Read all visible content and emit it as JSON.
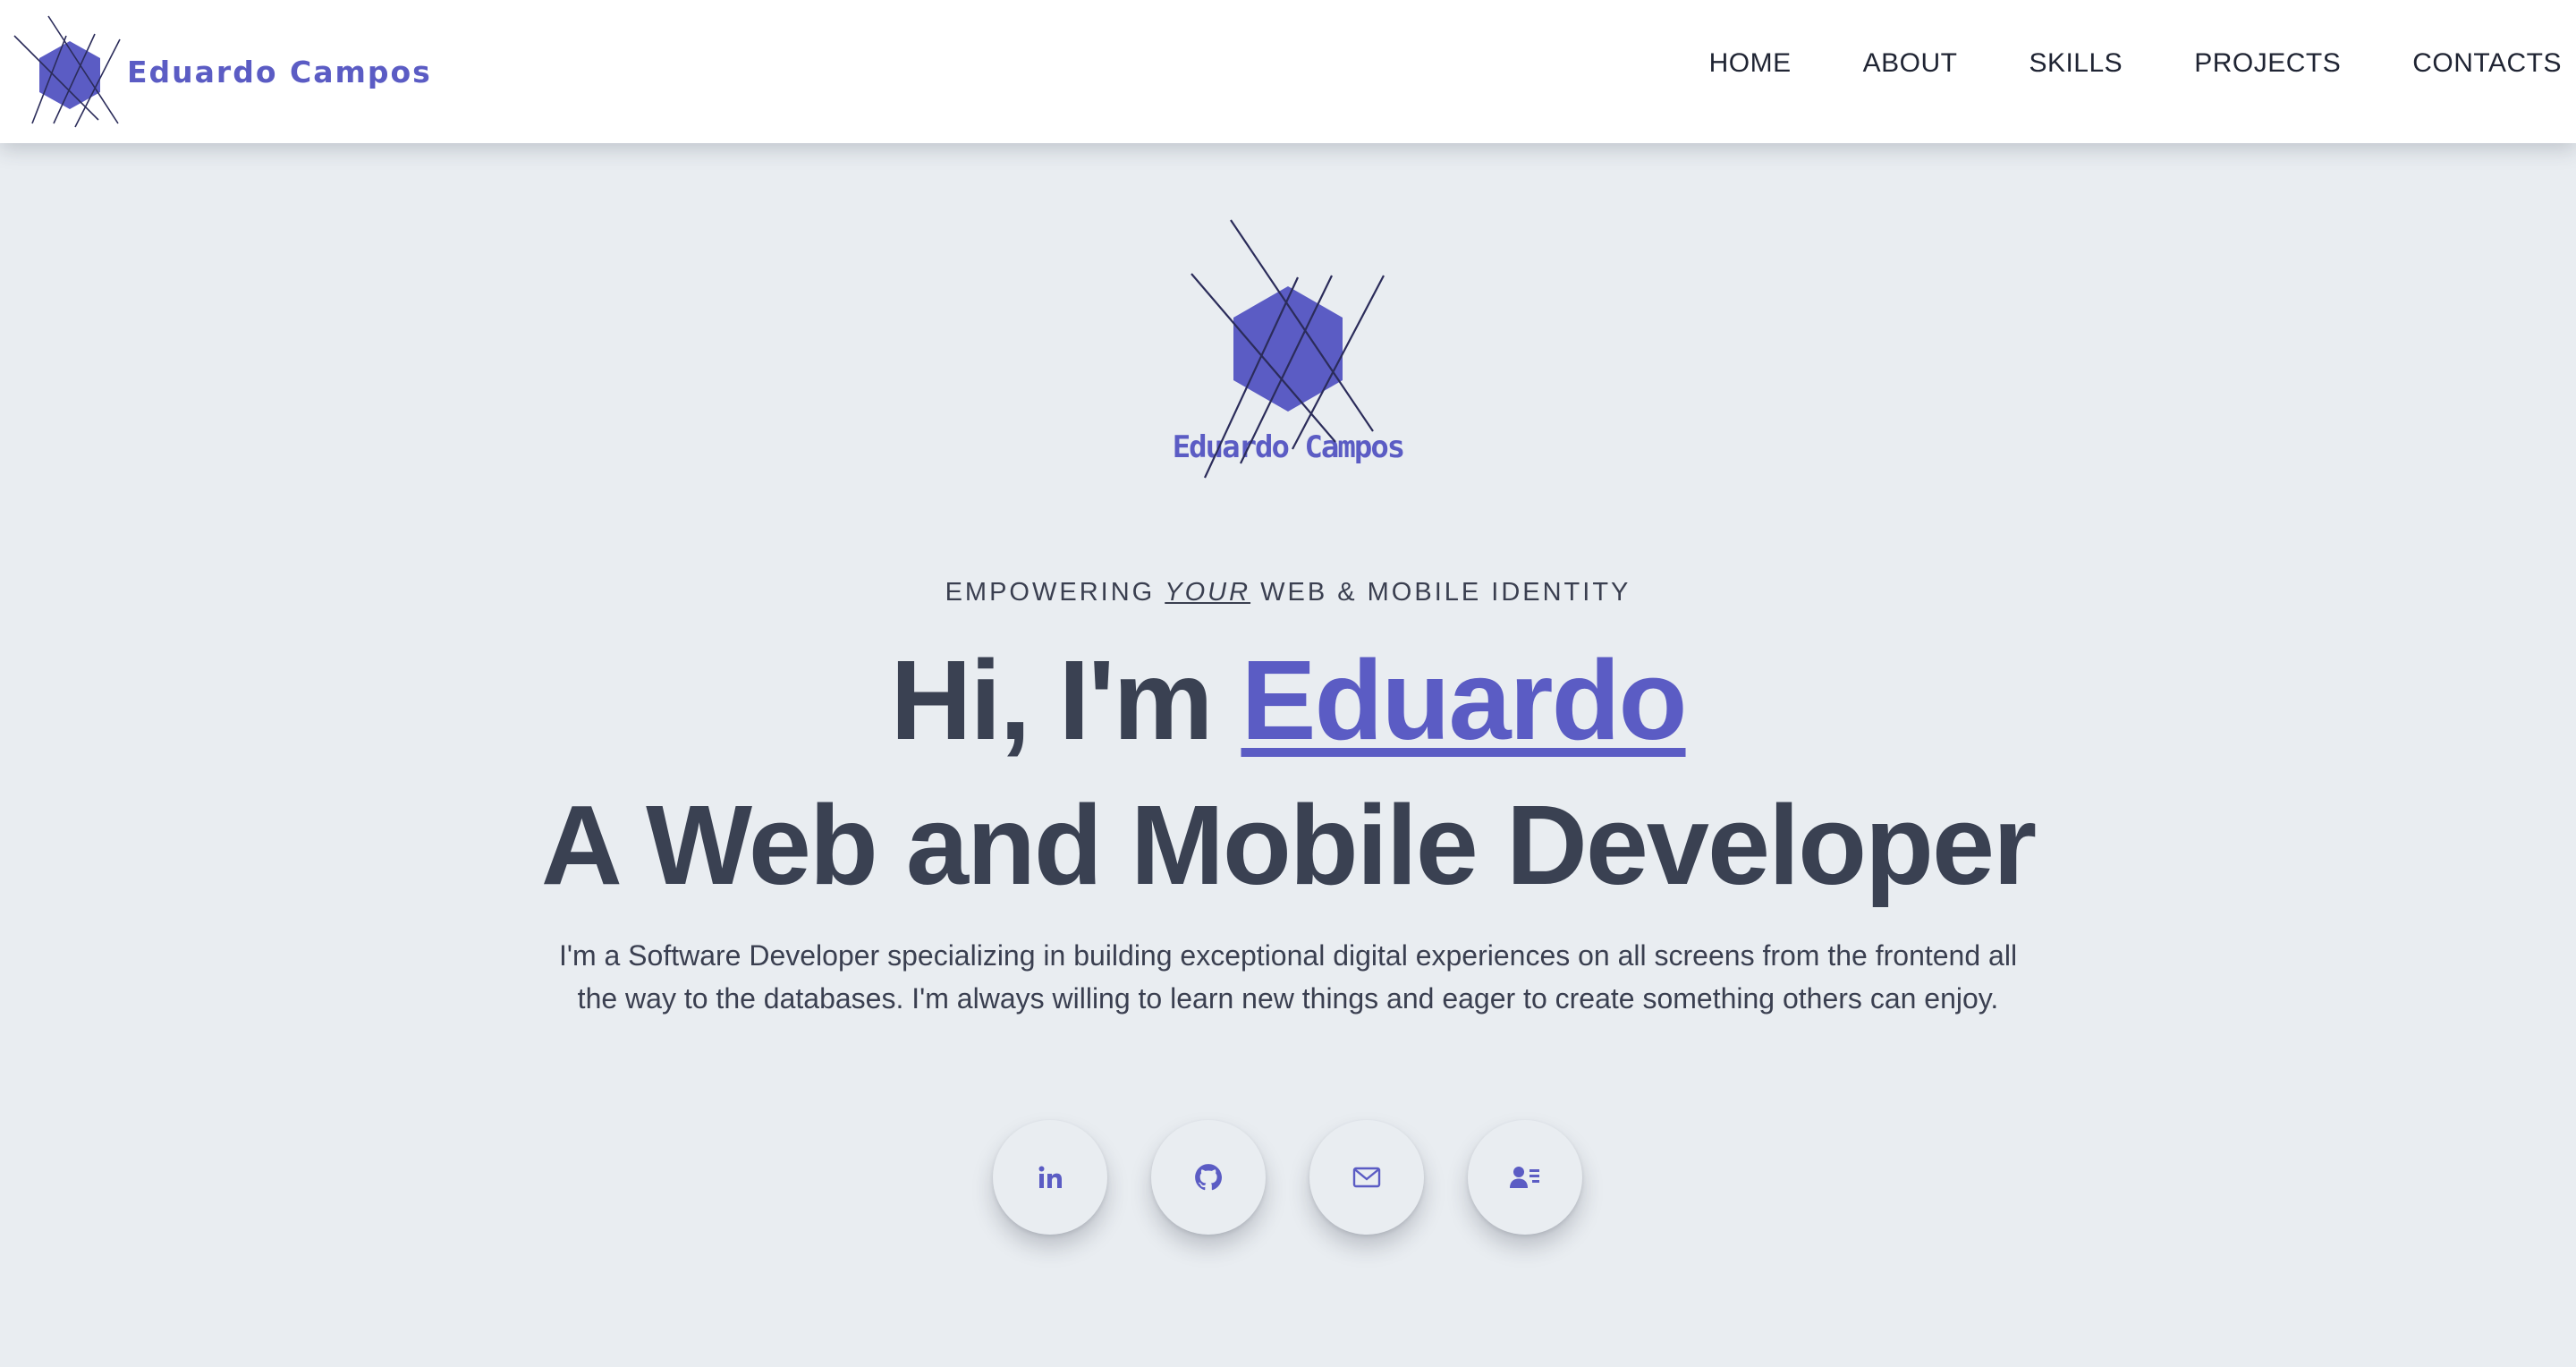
{
  "brand": {
    "name": "Eduardo Campos"
  },
  "nav": {
    "items": [
      {
        "label": "HOME"
      },
      {
        "label": "ABOUT"
      },
      {
        "label": "SKILLS"
      },
      {
        "label": "PROJECTS"
      },
      {
        "label": "CONTACTS"
      }
    ]
  },
  "hero": {
    "logo_text": "Eduardo Campos",
    "tagline_before": "EMPOWERING ",
    "tagline_emphasis": "YOUR",
    "tagline_after": " WEB & MOBILE IDENTITY",
    "greeting": "Hi, I'm ",
    "name": "Eduardo",
    "role": "A Web and Mobile Developer",
    "description": "I'm a Software Developer specializing in building exceptional digital experiences on all screens from the frontend all the way to the databases. I'm always willing to learn new things and eager to create something others can enjoy."
  },
  "socials": [
    {
      "icon": "linkedin-icon"
    },
    {
      "icon": "github-icon"
    },
    {
      "icon": "mail-icon"
    },
    {
      "icon": "contact-card-icon"
    }
  ],
  "colors": {
    "accent": "#5b5cc4",
    "heading": "#3a4152",
    "background": "#e9edf1",
    "navbar": "#ffffff"
  }
}
